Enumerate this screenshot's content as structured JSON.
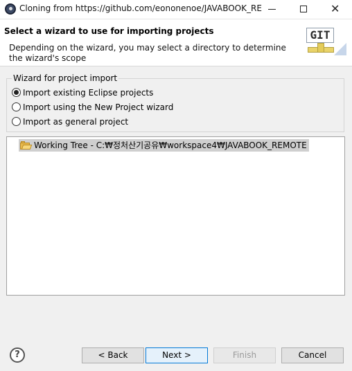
{
  "window": {
    "title": "Cloning from https://github.com/eononenoe/JAVABOOK_RE...",
    "close_glyph": "✕"
  },
  "header": {
    "title": "Select a wizard to use for importing projects",
    "description": "Depending on the wizard, you may select a directory to determine the wizard's scope",
    "logo_text": "GIT"
  },
  "wizard_group": {
    "legend": "Wizard for project import",
    "options": [
      {
        "label": "Import existing Eclipse projects",
        "checked": true
      },
      {
        "label": "Import using the New Project wizard",
        "checked": false
      },
      {
        "label": "Import as general project",
        "checked": false
      }
    ]
  },
  "tree": {
    "items": [
      {
        "label": "Working Tree - C:₩정처산기공유₩workspace4₩JAVABOOK_REMOTE",
        "icon": "folder-open-icon",
        "selected": true
      }
    ]
  },
  "footer": {
    "help_glyph": "?",
    "back_label": "< Back",
    "next_label": "Next >",
    "finish_label": "Finish",
    "cancel_label": "Cancel"
  }
}
